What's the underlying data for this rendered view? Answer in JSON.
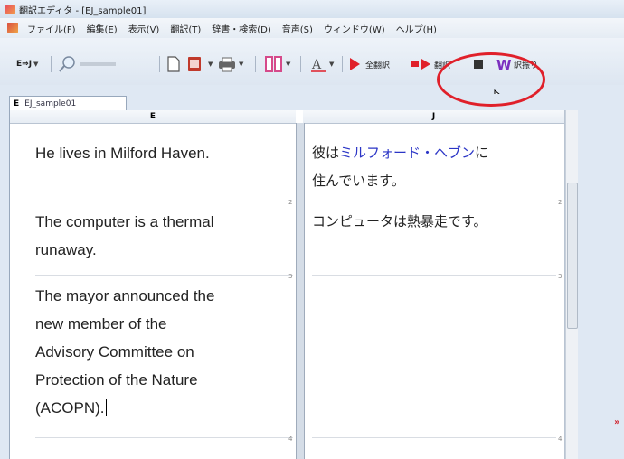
{
  "window": {
    "title": "翻訳エディタ - [EJ_sample01]"
  },
  "menu": {
    "items": [
      "ファイル(F)",
      "編集(E)",
      "表示(V)",
      "翻訳(T)",
      "辞書・検索(D)",
      "音声(S)",
      "ウィンドウ(W)",
      "ヘルプ(H)"
    ]
  },
  "toolbar": {
    "mode_label": "E⇒J",
    "full_translate_label": "全翻訳",
    "translate_label": "翻訳",
    "learn_label": "訳振り"
  },
  "tab": {
    "code": "E",
    "label": "EJ_sample01"
  },
  "columns": {
    "left_header": "E",
    "right_header": "J"
  },
  "rows": [
    {
      "number": "",
      "en_lines": [
        "He lives in Milford Haven."
      ],
      "ja_lines": [
        "彼は",
        "ミルフォード・ヘブン",
        "に",
        "住んでいます。"
      ]
    },
    {
      "number": "2",
      "en_lines": [
        "The computer is a thermal",
        "runaway."
      ],
      "ja_lines": [
        "コンピュータは熱暴走です。"
      ]
    },
    {
      "number": "3",
      "en_lines": [
        "The mayor announced the",
        "new member of the",
        "Advisory Committee on",
        "Protection of the Nature",
        "(ACOPN)."
      ],
      "ja_lines": []
    },
    {
      "number": "4",
      "en_lines": [],
      "ja_lines": []
    }
  ],
  "colors": {
    "highlight": "#2b35c6",
    "annotation": "#e0202a"
  }
}
